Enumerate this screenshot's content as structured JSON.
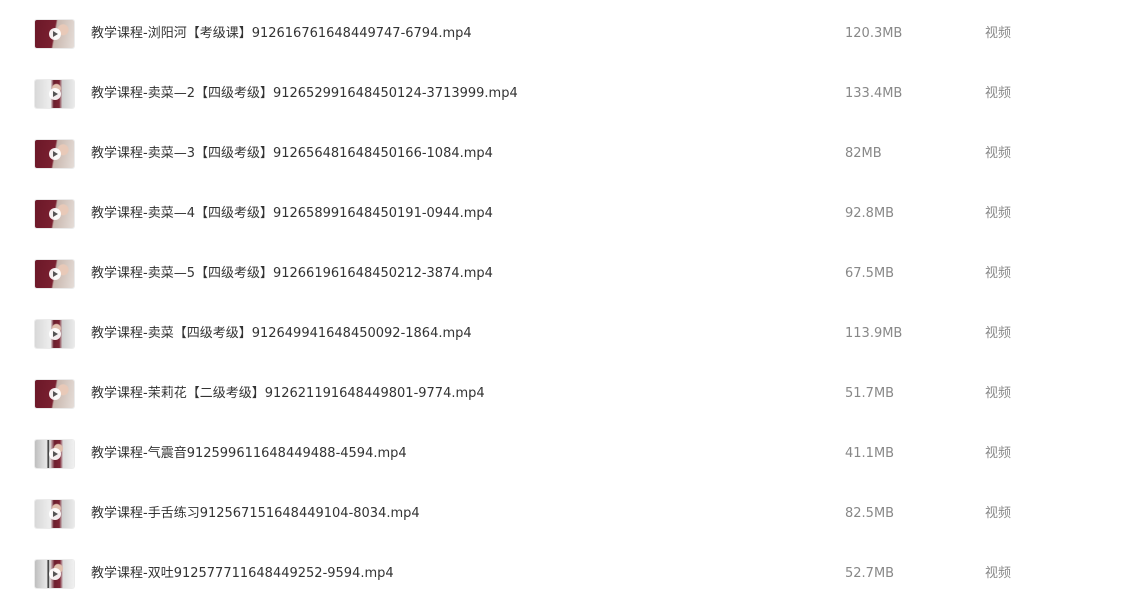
{
  "files": [
    {
      "name": "教学课程-浏阳河【考级课】912616761648449747-6794.mp4",
      "size": "120.3MB",
      "type": "视频",
      "thumb": "video-thumbnail-closeup"
    },
    {
      "name": "教学课程-卖菜—2【四级考级】912652991648450124-3713999.mp4",
      "size": "133.4MB",
      "type": "视频",
      "thumb": "video-thumbnail-wide"
    },
    {
      "name": "教学课程-卖菜—3【四级考级】912656481648450166-1084.mp4",
      "size": "82MB",
      "type": "视频",
      "thumb": "video-thumbnail-closeup"
    },
    {
      "name": "教学课程-卖菜—4【四级考级】912658991648450191-0944.mp4",
      "size": "92.8MB",
      "type": "视频",
      "thumb": "video-thumbnail-closeup"
    },
    {
      "name": "教学课程-卖菜—5【四级考级】912661961648450212-3874.mp4",
      "size": "67.5MB",
      "type": "视频",
      "thumb": "video-thumbnail-closeup"
    },
    {
      "name": "教学课程-卖菜【四级考级】912649941648450092-1864.mp4",
      "size": "113.9MB",
      "type": "视频",
      "thumb": "video-thumbnail-wide"
    },
    {
      "name": "教学课程-茉莉花【二级考级】912621191648449801-9774.mp4",
      "size": "51.7MB",
      "type": "视频",
      "thumb": "video-thumbnail-closeup"
    },
    {
      "name": "教学课程-气震音912599611648449488-4594.mp4",
      "size": "41.1MB",
      "type": "视频",
      "thumb": "video-thumbnail-stand"
    },
    {
      "name": "教学课程-手舌练习912567151648449104-8034.mp4",
      "size": "82.5MB",
      "type": "视频",
      "thumb": "video-thumbnail-wide"
    },
    {
      "name": "教学课程-双吐912577711648449252-9594.mp4",
      "size": "52.7MB",
      "type": "视频",
      "thumb": "video-thumbnail-stand"
    }
  ]
}
